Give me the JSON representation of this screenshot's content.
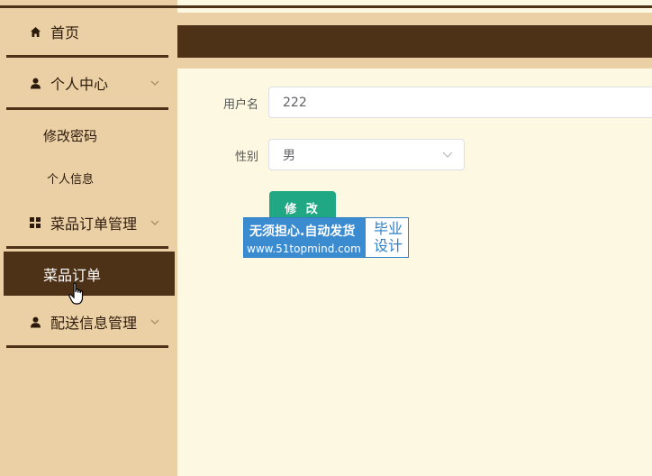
{
  "sidebar": {
    "home": {
      "label": "首页",
      "icon": "home-icon"
    },
    "personal_center": {
      "label": "个人中心",
      "icon": "user-icon"
    },
    "change_password": {
      "label": "修改密码"
    },
    "personal_info": {
      "label": "个人信息"
    },
    "order_mgmt": {
      "label": "菜品订单管理",
      "icon": "grid-icon"
    },
    "dish_orders": {
      "label": "菜品订单"
    },
    "delivery_mgmt": {
      "label": "配送信息管理",
      "icon": "user-icon"
    }
  },
  "form": {
    "username": {
      "label": "用户名",
      "value": "222"
    },
    "gender": {
      "label": "性别",
      "value": "男"
    },
    "submit_label": "修 改"
  },
  "watermark": {
    "line1": "无须担心.自动发货",
    "line2": "www.51topmind.com",
    "right_line1": "毕业",
    "right_line2": "设计"
  },
  "colors": {
    "sidebar_bg": "#ecd0a5",
    "dark_brown": "#4d3218",
    "content_bg": "#fdf8e1",
    "button_green": "#1fa883"
  }
}
